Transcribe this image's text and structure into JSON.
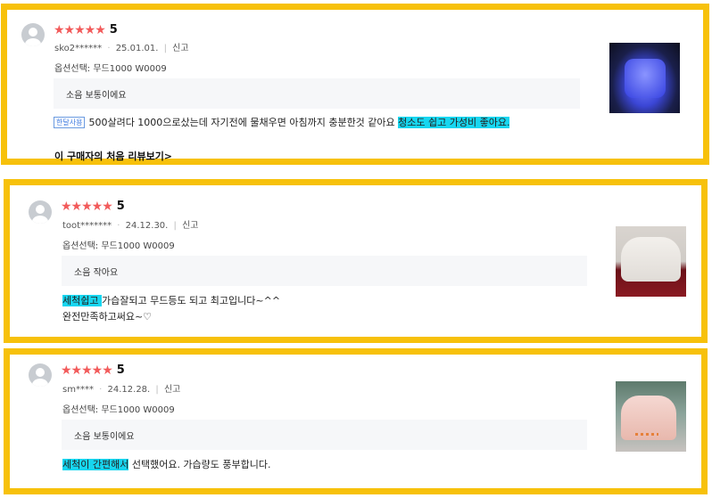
{
  "reviews": [
    {
      "score": "5",
      "user": "sko2******",
      "date": "25.01.01.",
      "report": "신고",
      "option": "옵션선택: 무드1000 W0009",
      "noise": "소음 보통이에요",
      "badge": "한달사용",
      "text_plain": "500살려다 1000으로샀는데 자기전에 물채우면 아침까지 충분한것 같아요 ",
      "text_highlight": "청소도 쉽고 가성비 좋아요.",
      "first_review_link": "이 구매자의 처음 리뷰보기>",
      "image": "blue-glowing-humidifier-photo"
    },
    {
      "score": "5",
      "user": "toot*******",
      "date": "24.12.30.",
      "report": "신고",
      "option": "옵션선택: 무드1000 W0009",
      "noise": "소음 작아요",
      "text_highlight": "세척쉽고 ",
      "text_plain": "가습잘되고 무드등도 되고 최고입니다~^^",
      "text_line2": "완전만족하고써요~♡",
      "image": "white-humidifier-photo"
    },
    {
      "score": "5",
      "user": "sm****",
      "date": "24.12.28.",
      "report": "신고",
      "option": "옵션선택: 무드1000 W0009",
      "noise": "소음 보통이에요",
      "text_highlight": "세척이 간편해서",
      "text_plain": " 선택했어요. 가습량도 풍부합니다.",
      "image": "pink-humidifier-photo"
    }
  ],
  "star_glyph": "★★★★★",
  "colors": {
    "border": "#f7c10b",
    "highlight": "#17d6f0",
    "star": "#f25b5b"
  }
}
